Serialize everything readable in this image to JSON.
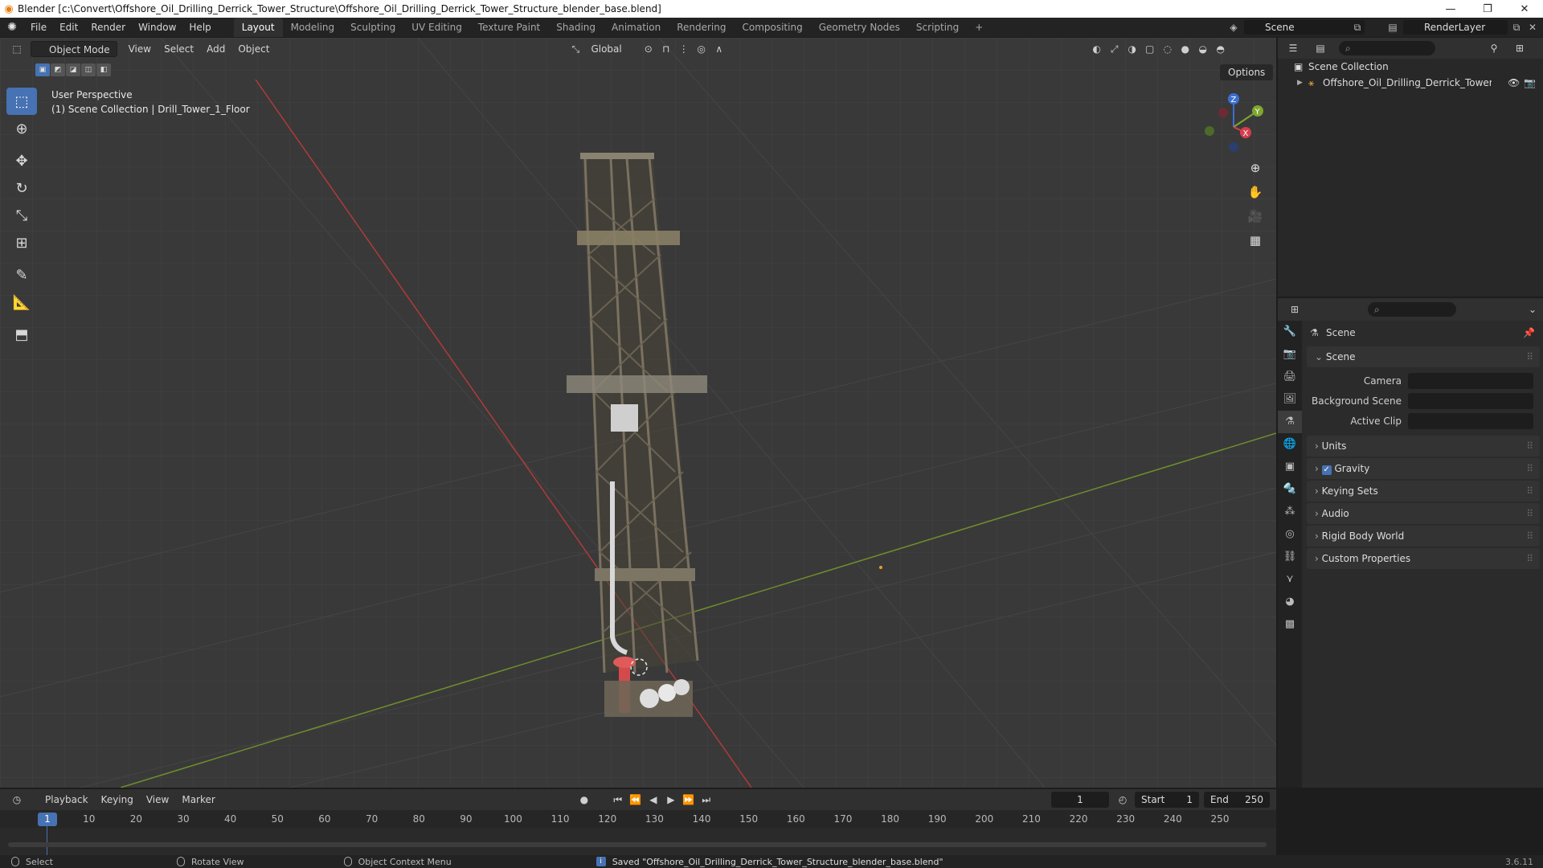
{
  "window": {
    "title": "Blender [c:\\Convert\\Offshore_Oil_Drilling_Derrick_Tower_Structure\\Offshore_Oil_Drilling_Derrick_Tower_Structure_blender_base.blend]",
    "minimize": "—",
    "maximize": "❐",
    "close": "✕"
  },
  "menu": [
    "File",
    "Edit",
    "Render",
    "Window",
    "Help"
  ],
  "workspaces": [
    "Layout",
    "Modeling",
    "Sculpting",
    "UV Editing",
    "Texture Paint",
    "Shading",
    "Animation",
    "Rendering",
    "Compositing",
    "Geometry Nodes",
    "Scripting",
    "+"
  ],
  "active_workspace": "Layout",
  "scene_name": "Scene",
  "view_layer": "RenderLayer",
  "viewport": {
    "mode": "Object Mode",
    "menus": [
      "View",
      "Select",
      "Add",
      "Object"
    ],
    "transform_orientation": "Global",
    "options": "Options",
    "view_name": "User Perspective",
    "context": "(1) Scene Collection | Drill_Tower_1_Floor",
    "axis_x": "X",
    "axis_y": "Y",
    "axis_z": "Z"
  },
  "outliner": {
    "root": "Scene Collection",
    "item": "Offshore_Oil_Drilling_Derrick_Tower_Str"
  },
  "properties": {
    "context": "Scene",
    "panel": "Scene",
    "rows": [
      {
        "label": "Camera",
        "value": ""
      },
      {
        "label": "Background Scene",
        "value": ""
      },
      {
        "label": "Active Clip",
        "value": ""
      }
    ],
    "sections": [
      "Units",
      "Gravity",
      "Keying Sets",
      "Audio",
      "Rigid Body World",
      "Custom Properties"
    ],
    "gravity_checked": true
  },
  "timeline": {
    "menus": [
      "Playback",
      "Keying",
      "View",
      "Marker"
    ],
    "current_frame": "1",
    "start_label": "Start",
    "start": "1",
    "end_label": "End",
    "end": "250",
    "ticks": [
      "1",
      "10",
      "20",
      "30",
      "40",
      "50",
      "60",
      "70",
      "80",
      "90",
      "100",
      "110",
      "120",
      "130",
      "140",
      "150",
      "160",
      "170",
      "180",
      "190",
      "200",
      "210",
      "220",
      "230",
      "240",
      "250"
    ]
  },
  "statusbar": {
    "select": "Select",
    "rotate": "Rotate View",
    "context_menu": "Object Context Menu",
    "message": "Saved \"Offshore_Oil_Drilling_Derrick_Tower_Structure_blender_base.blend\"",
    "version": "3.6.11"
  }
}
